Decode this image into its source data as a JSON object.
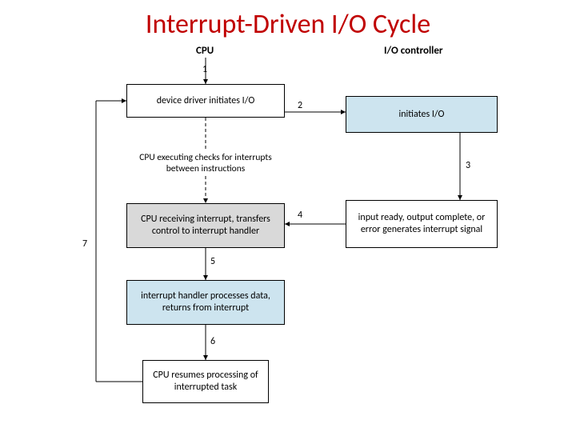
{
  "title": "Interrupt-Driven I/O Cycle",
  "headers": {
    "cpu": "CPU",
    "io_controller": "I/O controller"
  },
  "boxes": {
    "driver_initiates": "device driver initiates I/O",
    "initiates_io": "initiates I/O",
    "cpu_checks": "CPU executing checks for interrupts between instructions",
    "cpu_receiving": "CPU receiving interrupt, transfers control to interrupt handler",
    "input_ready": "input ready, output complete, or error generates interrupt signal",
    "handler_processes": "interrupt handler processes data, returns from interrupt",
    "cpu_resumes": "CPU resumes processing of interrupted task"
  },
  "steps": {
    "s1": "1",
    "s2": "2",
    "s3": "3",
    "s4": "4",
    "s5": "5",
    "s6": "6",
    "s7": "7"
  }
}
